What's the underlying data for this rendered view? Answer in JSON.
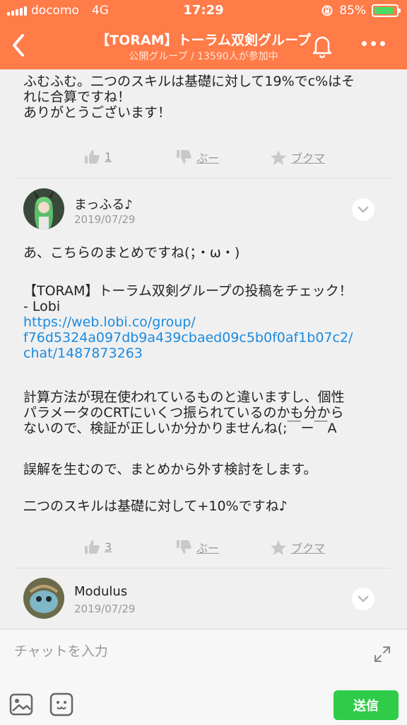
{
  "status_bar": {
    "carrier": "docomo",
    "network": "4G",
    "time": "17:29",
    "battery": "85%",
    "battery_level": 0.85
  },
  "navbar": {
    "title": "【TORAM】トーラム双剣グループ",
    "subtitle": "公開グループ / 13590人が参加中"
  },
  "messages": [
    {
      "lines": [
        "ふむふむ。二つのスキルは基礎に対して19%でc%はそ",
        "れに合算ですね！",
        "ありがとうございます！"
      ],
      "actions": {
        "like": "1",
        "dislike": "ぶー",
        "bookmark": "ブクマ"
      }
    },
    {
      "user": "まっふる♪",
      "date": "2019/07/29",
      "lines": [
        "あ、こちらのまとめですね(；・ω・)",
        "【TORAM】トーラム双剣グループの投稿をチェック！",
        "- Lobi",
        "https://web.lobi.co/group/",
        "f76d5324a097db9a439cbaed09c5b0f0af1b07c2/",
        "chat/1487873263",
        "計算方法が現在使われているものと違いますし、個性",
        "パラメータのCRTにいくつ振られているのかも分から",
        "ないので、検証が正しいか分かりませんね(;￣ー￣A",
        "誤解を生むので、まとめから外す検討をします。",
        "二つのスキルは基礎に対して+10%ですね♪"
      ],
      "actions": {
        "like": "3",
        "dislike": "ぶー",
        "bookmark": "ブクマ"
      }
    },
    {
      "user": "Modulus",
      "date": "2019/07/29"
    }
  ],
  "input": {
    "placeholder": "チャットを入力",
    "send_label": "送信"
  },
  "colors": {
    "accent": "#ff7b48",
    "link": "#1a8be0",
    "send": "#2ecc48"
  }
}
